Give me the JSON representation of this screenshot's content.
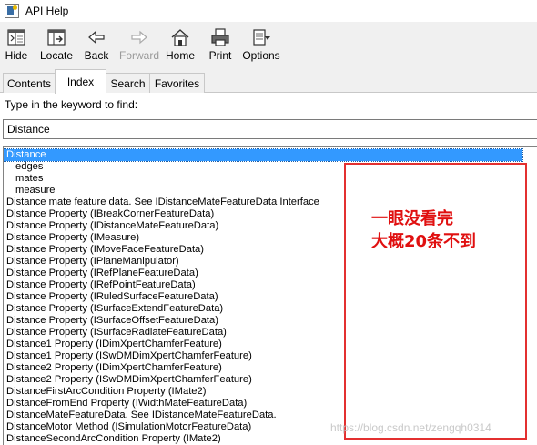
{
  "window": {
    "title": "API Help"
  },
  "toolbar": {
    "hide": "Hide",
    "locate": "Locate",
    "back": "Back",
    "forward": "Forward",
    "home": "Home",
    "print": "Print",
    "options": "Options"
  },
  "tabs": [
    {
      "label": "Contents",
      "active": false
    },
    {
      "label": "Index",
      "active": true
    },
    {
      "label": "Search",
      "active": false
    },
    {
      "label": "Favorites",
      "active": false
    }
  ],
  "index": {
    "prompt": "Type in the keyword to find:",
    "keyword_value": "Distance",
    "items": [
      {
        "label": "Distance",
        "indent": 0,
        "selected": true
      },
      {
        "label": "edges",
        "indent": 1,
        "selected": false
      },
      {
        "label": "mates",
        "indent": 1,
        "selected": false
      },
      {
        "label": "measure",
        "indent": 1,
        "selected": false
      },
      {
        "label": "Distance mate feature data. See IDistanceMateFeatureData Interface",
        "indent": 0,
        "selected": false
      },
      {
        "label": "Distance Property (IBreakCornerFeatureData)",
        "indent": 0,
        "selected": false
      },
      {
        "label": "Distance Property (IDistanceMateFeatureData)",
        "indent": 0,
        "selected": false
      },
      {
        "label": "Distance Property (IMeasure)",
        "indent": 0,
        "selected": false
      },
      {
        "label": "Distance Property (IMoveFaceFeatureData)",
        "indent": 0,
        "selected": false
      },
      {
        "label": "Distance Property (IPlaneManipulator)",
        "indent": 0,
        "selected": false
      },
      {
        "label": "Distance Property (IRefPlaneFeatureData)",
        "indent": 0,
        "selected": false
      },
      {
        "label": "Distance Property (IRefPointFeatureData)",
        "indent": 0,
        "selected": false
      },
      {
        "label": "Distance Property (IRuledSurfaceFeatureData)",
        "indent": 0,
        "selected": false
      },
      {
        "label": "Distance Property (ISurfaceExtendFeatureData)",
        "indent": 0,
        "selected": false
      },
      {
        "label": "Distance Property (ISurfaceOffsetFeatureData)",
        "indent": 0,
        "selected": false
      },
      {
        "label": "Distance Property (ISurfaceRadiateFeatureData)",
        "indent": 0,
        "selected": false
      },
      {
        "label": "Distance1 Property (IDimXpertChamferFeature)",
        "indent": 0,
        "selected": false
      },
      {
        "label": "Distance1 Property (ISwDMDimXpertChamferFeature)",
        "indent": 0,
        "selected": false
      },
      {
        "label": "Distance2 Property (IDimXpertChamferFeature)",
        "indent": 0,
        "selected": false
      },
      {
        "label": "Distance2 Property (ISwDMDimXpertChamferFeature)",
        "indent": 0,
        "selected": false
      },
      {
        "label": "DistanceFirstArcCondition Property (IMate2)",
        "indent": 0,
        "selected": false
      },
      {
        "label": "DistanceFromEnd Property (IWidthMateFeatureData)",
        "indent": 0,
        "selected": false
      },
      {
        "label": "DistanceMateFeatureData. See IDistanceMateFeatureData.",
        "indent": 0,
        "selected": false
      },
      {
        "label": "DistanceMotor Method (ISimulationMotorFeatureData)",
        "indent": 0,
        "selected": false
      },
      {
        "label": "DistanceSecondArcCondition Property (IMate2)",
        "indent": 0,
        "selected": false
      }
    ]
  },
  "annotation": {
    "line1": "一眼没看完",
    "line2": "大概20条不到",
    "color": "#e01010"
  },
  "watermark": "https://blog.csdn.net/zengqh0314",
  "colors": {
    "selection": "#3399ff",
    "annotation_border": "#e33030"
  }
}
